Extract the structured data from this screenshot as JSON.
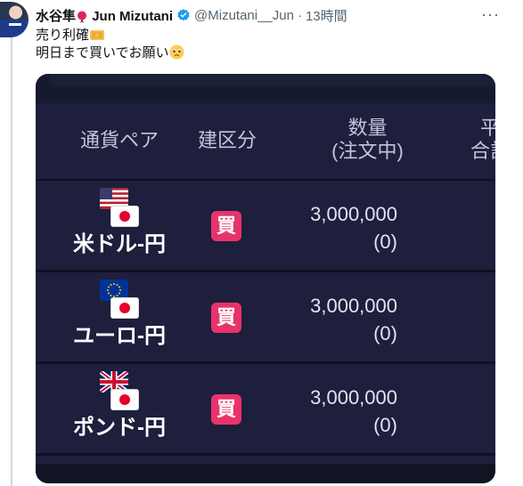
{
  "tweet": {
    "display_name_main": "水谷隼",
    "display_name_en": "Jun Mizutani",
    "handle": "@Mizutani__Jun",
    "separator": "·",
    "time_ago": "13時間",
    "more_label": "···",
    "line1": "売り利確",
    "line2": "明日まで買いでお願い"
  },
  "icons": {
    "name_emoji": "red-pin-icon",
    "line1_emoji": "money-bag-icon",
    "line2_emoji": "pleading-face-icon",
    "verified": "verified-badge-icon"
  },
  "media": {
    "headers": {
      "pair": "通貨ペア",
      "side": "建区分",
      "qty_line1": "数量",
      "qty_line2": "(注文中)",
      "avg_line1": "平",
      "avg_line2": "合計"
    },
    "rows": [
      {
        "pair": "米ドル-円",
        "flag": "us-flag-icon",
        "side": "買",
        "qty": "3,000,000",
        "pending": "(0)"
      },
      {
        "pair": "ユーロ-円",
        "flag": "eu-flag-icon",
        "side": "買",
        "qty": "3,000,000",
        "pending": "(0)"
      },
      {
        "pair": "ポンド-円",
        "flag": "uk-flag-icon",
        "side": "買",
        "qty": "3,000,000",
        "pending": "(0)"
      }
    ]
  },
  "colors": {
    "panel_bg": "#1d1f3d",
    "buy_badge": "#e8336a",
    "verified_blue": "#1d9bf0"
  }
}
